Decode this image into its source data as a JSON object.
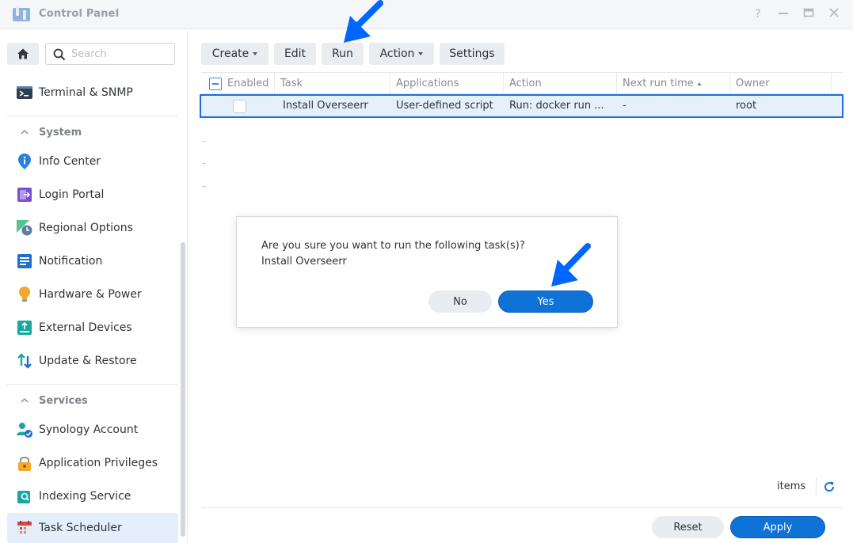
{
  "window": {
    "title": "Control Panel",
    "controls": [
      "help",
      "minimize",
      "maximize",
      "close"
    ]
  },
  "sidebar": {
    "search_placeholder": "Search",
    "items": [
      {
        "label": "Terminal & SNMP",
        "icon": "terminal-icon"
      },
      {
        "label": "Info Center",
        "icon": "info-icon"
      },
      {
        "label": "Login Portal",
        "icon": "login-portal-icon"
      },
      {
        "label": "Regional Options",
        "icon": "globe-clock-icon"
      },
      {
        "label": "Notification",
        "icon": "notification-icon"
      },
      {
        "label": "Hardware & Power",
        "icon": "lightbulb-icon"
      },
      {
        "label": "External Devices",
        "icon": "external-device-icon"
      },
      {
        "label": "Update & Restore",
        "icon": "update-icon"
      },
      {
        "label": "Synology Account",
        "icon": "account-icon"
      },
      {
        "label": "Application Privileges",
        "icon": "lock-icon"
      },
      {
        "label": "Indexing Service",
        "icon": "indexing-icon"
      },
      {
        "label": "Task Scheduler",
        "icon": "calendar-icon",
        "active": true
      }
    ],
    "sections": {
      "system": "System",
      "services": "Services"
    }
  },
  "toolbar": {
    "create": "Create",
    "edit": "Edit",
    "run": "Run",
    "action": "Action",
    "settings": "Settings"
  },
  "grid": {
    "columns": [
      "Enabled",
      "Task",
      "Applications",
      "Action",
      "Next run time",
      "Owner"
    ],
    "rows": [
      {
        "enabled": false,
        "task": "Install Overseerr",
        "application": "User-defined script",
        "action": "Run: docker run ...",
        "next_run": "-",
        "owner": "root"
      }
    ]
  },
  "dialog": {
    "line1": "Are you sure you want to run the following task(s)?",
    "line2": "Install Overseerr",
    "no": "No",
    "yes": "Yes"
  },
  "footer": {
    "items_label": "items",
    "reset": "Reset",
    "apply": "Apply"
  },
  "colors": {
    "accent": "#0f72d6",
    "selection_border": "#1d6fe0",
    "annotation_arrow": "#0066ff"
  }
}
